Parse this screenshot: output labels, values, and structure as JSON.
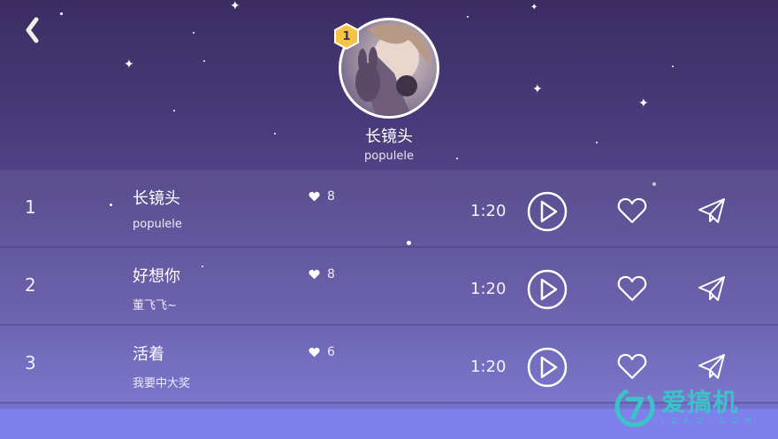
{
  "album": {
    "rank_badge": "1",
    "title": "长镜头",
    "artist": "populele"
  },
  "songs": [
    {
      "index": "1",
      "title": "长镜头",
      "artist": "populele",
      "likes": "8",
      "duration": "1:20"
    },
    {
      "index": "2",
      "title": "好想你",
      "artist": "董飞飞~",
      "likes": "8",
      "duration": "1:20"
    },
    {
      "index": "3",
      "title": "活着",
      "artist": "我要中大奖",
      "likes": "6",
      "duration": "1:20"
    }
  ],
  "icons": {
    "back": "chevron-left-icon",
    "like_count": "heart-icon",
    "play": "play-icon",
    "favorite": "heart-outline-icon",
    "share": "paper-plane-icon"
  },
  "watermark": {
    "main": "爱搞机",
    "sub": "I G A O . C O M"
  },
  "colors": {
    "badge": "#f6c445",
    "watermark": "#3bc3c7"
  }
}
